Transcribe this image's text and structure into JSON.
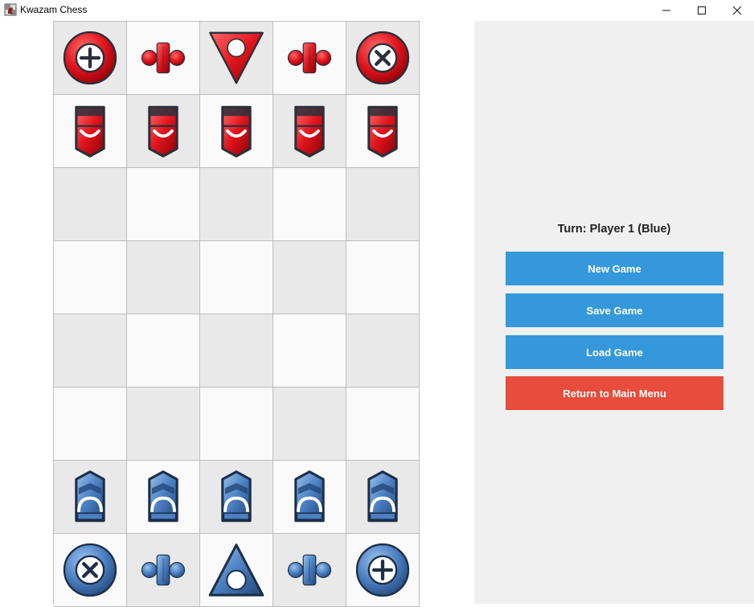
{
  "window": {
    "title": "Kwazam Chess"
  },
  "colors": {
    "board_dark": "#e9e9e9",
    "board_light": "#fafafa",
    "red_piece": "#e0141c",
    "blue_piece": "#4a7fc1",
    "button_blue": "#3498db",
    "button_red": "#e74c3c",
    "panel_bg": "#f0f0f0"
  },
  "board": {
    "columns": 5,
    "rows": 8,
    "cells": [
      [
        {
          "piece": "tor",
          "color": "red"
        },
        {
          "piece": "biz",
          "color": "red"
        },
        {
          "piece": "sau",
          "color": "red"
        },
        {
          "piece": "biz",
          "color": "red"
        },
        {
          "piece": "xor",
          "color": "red"
        }
      ],
      [
        {
          "piece": "ram",
          "color": "red"
        },
        {
          "piece": "ram",
          "color": "red"
        },
        {
          "piece": "ram",
          "color": "red"
        },
        {
          "piece": "ram",
          "color": "red"
        },
        {
          "piece": "ram",
          "color": "red"
        }
      ],
      [
        null,
        null,
        null,
        null,
        null
      ],
      [
        null,
        null,
        null,
        null,
        null
      ],
      [
        null,
        null,
        null,
        null,
        null
      ],
      [
        null,
        null,
        null,
        null,
        null
      ],
      [
        {
          "piece": "ram",
          "color": "blue"
        },
        {
          "piece": "ram",
          "color": "blue"
        },
        {
          "piece": "ram",
          "color": "blue"
        },
        {
          "piece": "ram",
          "color": "blue"
        },
        {
          "piece": "ram",
          "color": "blue"
        }
      ],
      [
        {
          "piece": "xor",
          "color": "blue"
        },
        {
          "piece": "biz",
          "color": "blue"
        },
        {
          "piece": "sau",
          "color": "blue"
        },
        {
          "piece": "biz",
          "color": "blue"
        },
        {
          "piece": "tor",
          "color": "blue"
        }
      ]
    ]
  },
  "panel": {
    "turn_label": "Turn: Player 1 (Blue)",
    "buttons": {
      "new_game": "New Game",
      "save_game": "Save Game",
      "load_game": "Load Game",
      "main_menu": "Return to Main Menu"
    }
  }
}
